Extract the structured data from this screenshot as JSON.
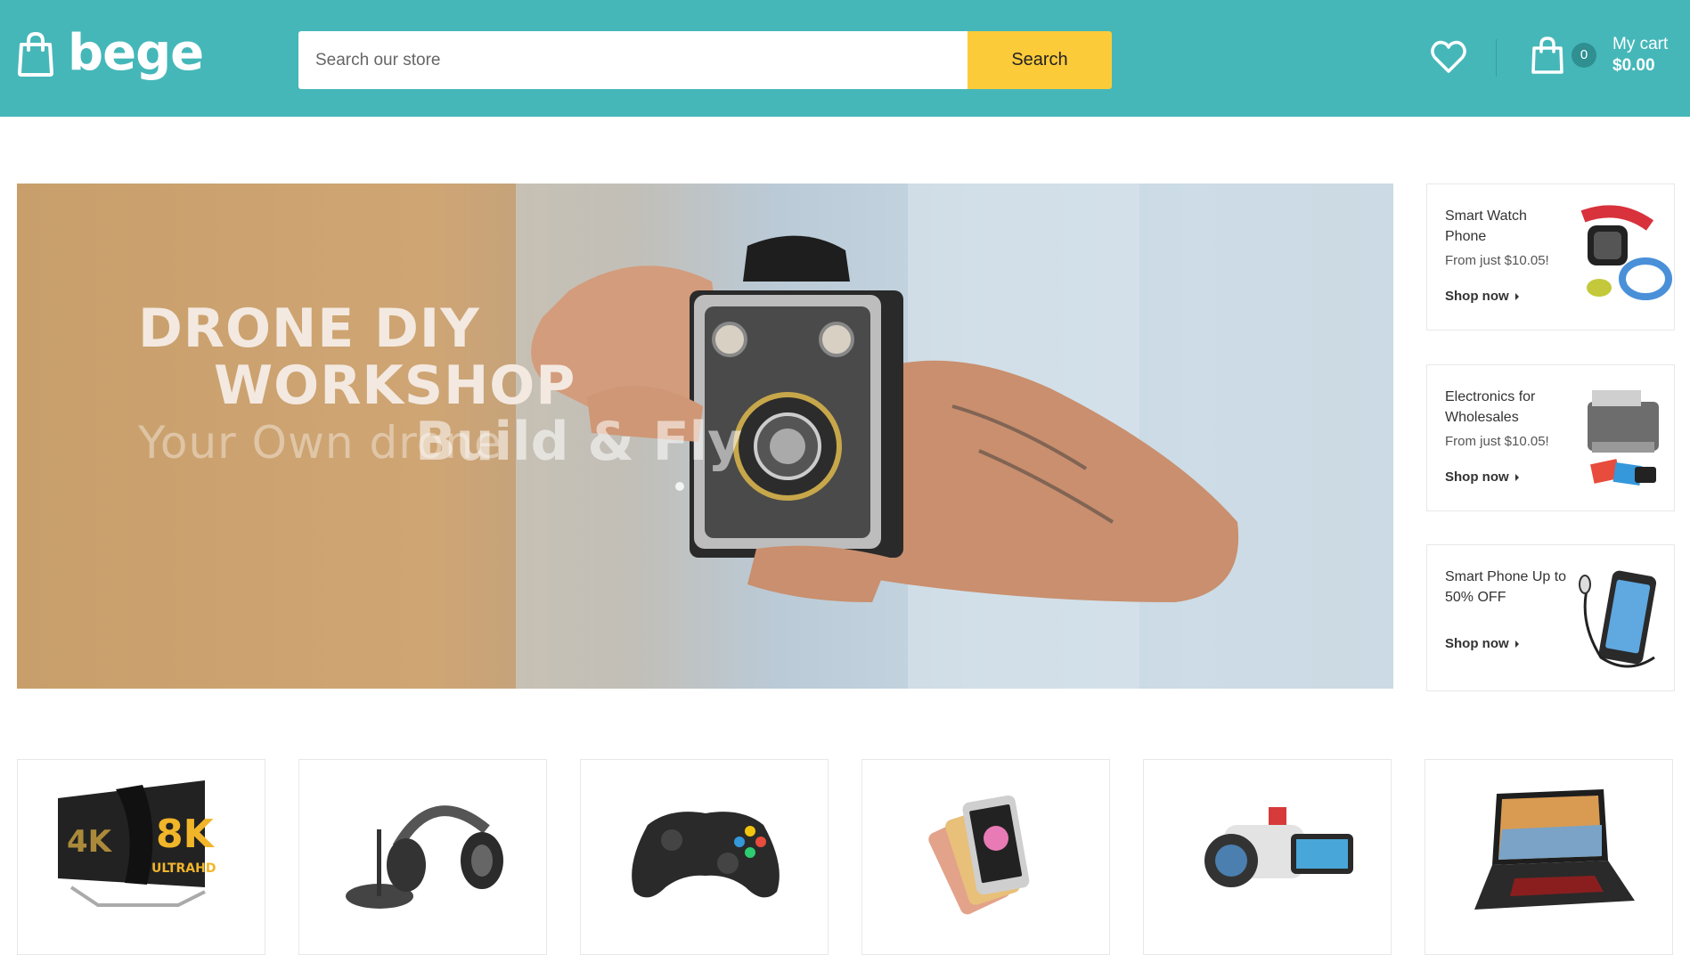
{
  "header": {
    "logo_text": "bege",
    "search_placeholder": "Search our store",
    "search_button": "Search",
    "cart_count": "0",
    "cart_label": "My cart",
    "cart_total": "$0.00"
  },
  "hero": {
    "line1": "DRONE DIY",
    "line2": "WORKSHOP",
    "line3_faded": "Your Own drone",
    "line3_overlay": "Build & Fly"
  },
  "promos": [
    {
      "title": "Smart Watch Phone",
      "price": "From just $10.05!",
      "link": "Shop now"
    },
    {
      "title": "Electronics for Wholesales",
      "price": "From just $10.05!",
      "link": "Shop now"
    },
    {
      "title": "Smart Phone Up to 50% OFF",
      "link": "Shop now"
    }
  ],
  "categories": [
    {
      "icon": "tv-8k-icon"
    },
    {
      "icon": "headphones-icon"
    },
    {
      "icon": "gamepad-icon"
    },
    {
      "icon": "smartphone-icon"
    },
    {
      "icon": "camcorder-icon"
    },
    {
      "icon": "laptop-icon"
    }
  ],
  "colors": {
    "header_bg": "#45b7b9",
    "search_button": "#fccb3a",
    "cart_badge": "#2f8f91"
  }
}
